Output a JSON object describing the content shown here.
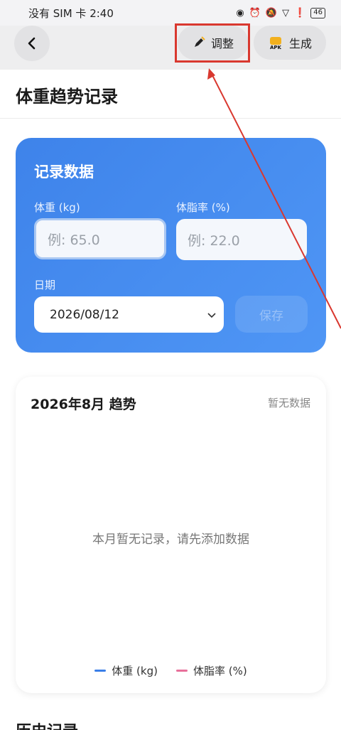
{
  "status_bar": {
    "carrier_time": "没有 SIM 卡 2:40",
    "battery": "46",
    "icons": [
      "eye-icon",
      "alarm-icon",
      "mute-icon",
      "wifi-icon",
      "alert-icon",
      "battery-icon"
    ]
  },
  "toolbar": {
    "adjust_label": "调整",
    "generate_label": "生成",
    "apk_badge": "APK"
  },
  "page": {
    "title": "体重趋势记录"
  },
  "record_card": {
    "title": "记录数据",
    "weight_label": "体重 (kg)",
    "weight_placeholder": "例: 65.0",
    "bodyfat_label": "体脂率 (%)",
    "bodyfat_placeholder": "例: 22.0",
    "date_label": "日期",
    "date_value": "2026/08/12",
    "save_label": "保存"
  },
  "trend_card": {
    "title": "2026年8月 趋势",
    "status": "暂无数据",
    "empty_message": "本月暂无记录，请先添加数据",
    "legend": [
      {
        "label": "体重 (kg)",
        "color": "#3a7ee8"
      },
      {
        "label": "体脂率 (%)",
        "color": "#e8709a"
      }
    ]
  },
  "history": {
    "title": "历史记录"
  },
  "colors": {
    "accent": "#3e83ea",
    "annotation": "#d9382f"
  }
}
